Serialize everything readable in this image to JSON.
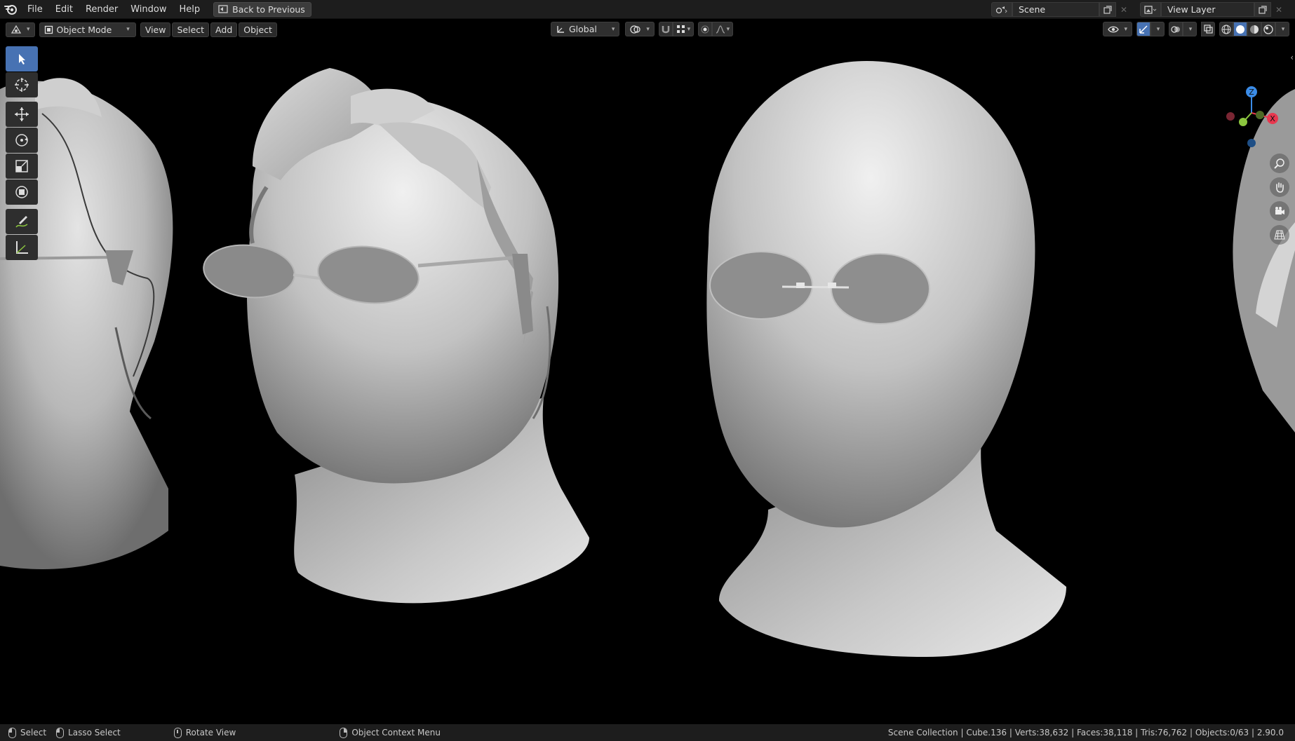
{
  "menu": {
    "items": [
      "File",
      "Edit",
      "Render",
      "Window",
      "Help"
    ],
    "back_button": "Back to Previous"
  },
  "scene": {
    "scene_name": "Scene",
    "view_layer": "View Layer"
  },
  "header": {
    "mode": "Object Mode",
    "menus": [
      "View",
      "Select",
      "Add",
      "Object"
    ],
    "orientation": "Global"
  },
  "toolbar": {
    "tools": [
      "select-box",
      "cursor",
      "move",
      "rotate",
      "scale",
      "transform",
      "annotate",
      "measure"
    ],
    "active": "select-box"
  },
  "gizmo": {
    "z": "Z",
    "x": "X"
  },
  "status": {
    "select": "Select",
    "lasso": "Lasso Select",
    "rotate": "Rotate View",
    "context": "Object Context Menu",
    "stats": "Scene Collection | Cube.136 | Verts:38,632 | Faces:38,118 | Tris:76,762 | Objects:0/63 | 2.90.0"
  },
  "colors": {
    "accent": "#4772b3",
    "x_axis": "#e8384f",
    "y_axis": "#8cc63f",
    "z_axis": "#3b8ce8"
  }
}
